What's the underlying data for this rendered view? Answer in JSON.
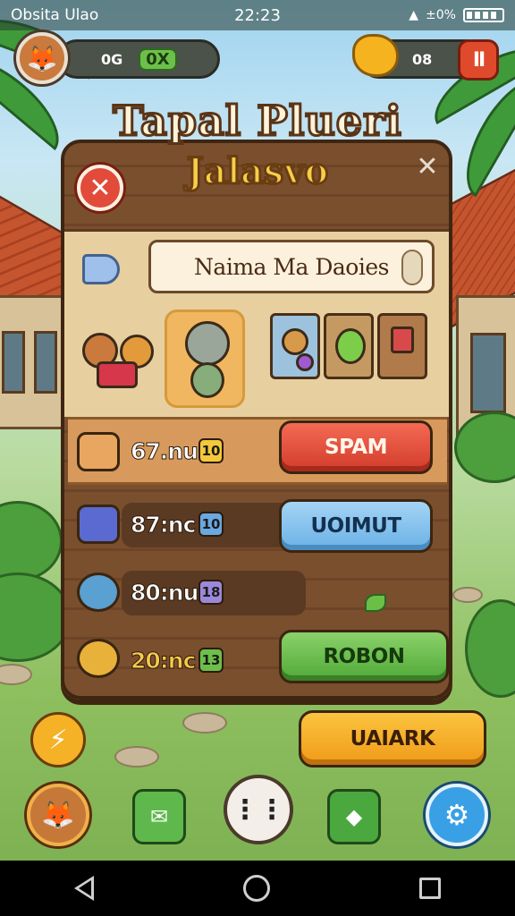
{
  "status_bar": {
    "left_text": "Obsita Ulao",
    "time": "22:23",
    "right_text": "±0%"
  },
  "hud": {
    "left_count": "0G",
    "gem_value": "0X",
    "right_count": "08",
    "pause_label": "II"
  },
  "title": {
    "main": "Tapal Plueri",
    "sub": "Jalasvo"
  },
  "banner": {
    "text": "Naima Ma Daoies"
  },
  "rows": [
    {
      "label": "67.nu",
      "badge": "10",
      "badge_color": "#f3c93a",
      "button": "SPAM"
    },
    {
      "label": "87:nc",
      "badge": "10",
      "badge_color": "#6aa8e0",
      "button": "UOIMUT"
    },
    {
      "label": "80:nu",
      "badge": "18",
      "badge_color": "#9c88d8"
    },
    {
      "label": "20:nc",
      "badge": "13",
      "badge_color": "#6cc04a",
      "button": "ROBON"
    }
  ],
  "bottom": {
    "action_button": "UAIARK"
  },
  "colors": {
    "accent_red": "#e04a2c",
    "accent_blue": "#6ab1e6",
    "accent_green": "#4fa836",
    "accent_orange": "#f09a18",
    "panel_wood": "#7a4f2e"
  },
  "icons": [
    "close-icon",
    "pause-icon",
    "gold-icon",
    "lightning-icon",
    "settings-icon",
    "arrow-icon"
  ]
}
